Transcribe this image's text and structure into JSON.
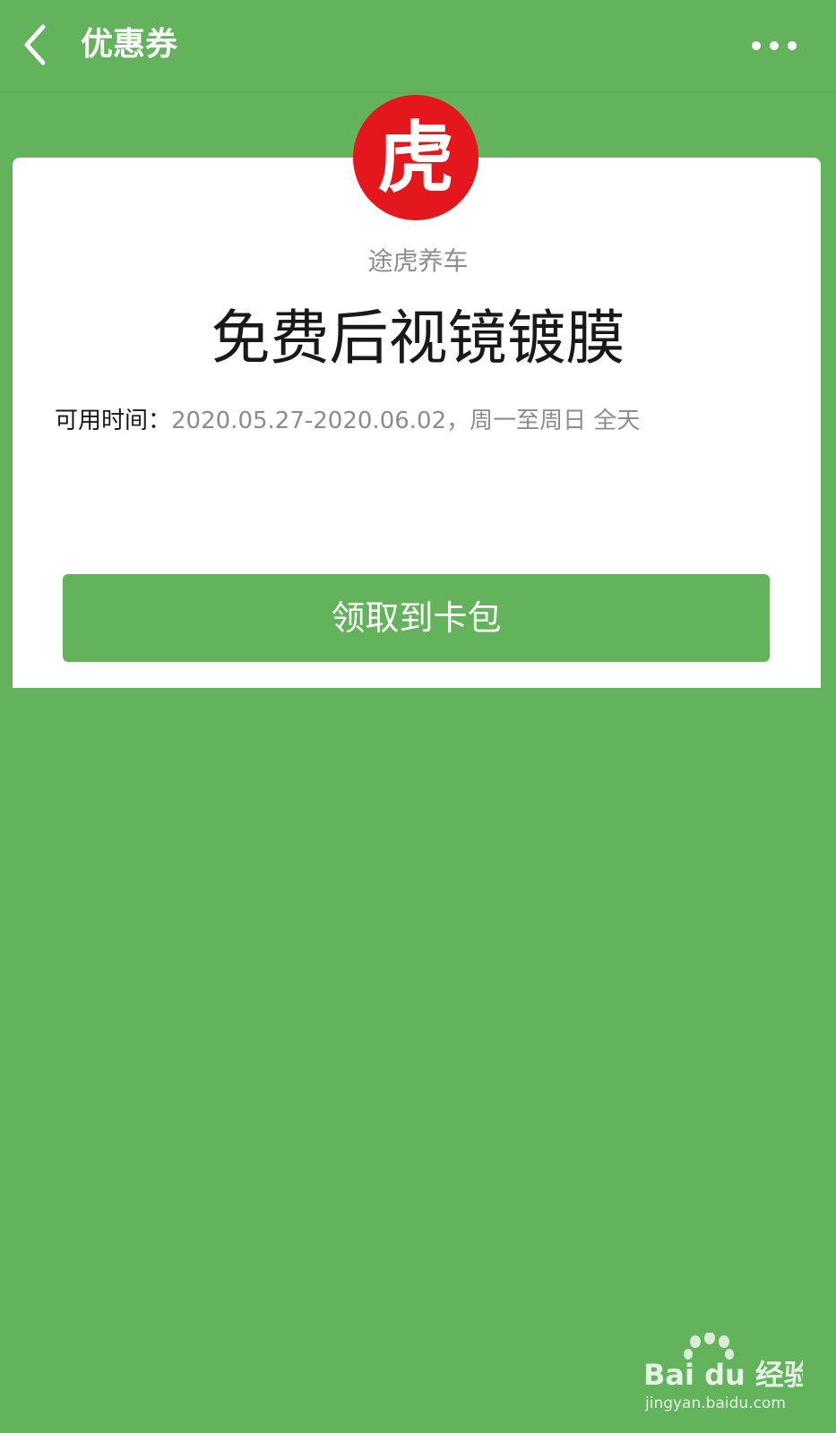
{
  "nav": {
    "title": "优惠券",
    "back_icon": "chevron-left-icon",
    "more_icon": "more-dots-icon"
  },
  "coupon": {
    "logo_icon": "tiger-brand-logo",
    "logo_text": "虎",
    "merchant_name": "途虎养车",
    "title": "免费后视镜镀膜",
    "validity_label": "可用时间：",
    "validity_value": "2020.05.27-2020.06.02，周一至周日 全天",
    "claim_button_label": "领取到卡包"
  },
  "watermark": {
    "brand_text": "Bai du 经验",
    "url_text": "jingyan.baidu.com"
  },
  "colors": {
    "background": "#63b25c",
    "card": "#ffffff",
    "logo_red": "#e4171d",
    "text_primary": "#191919",
    "text_secondary": "#8c8c8c"
  }
}
